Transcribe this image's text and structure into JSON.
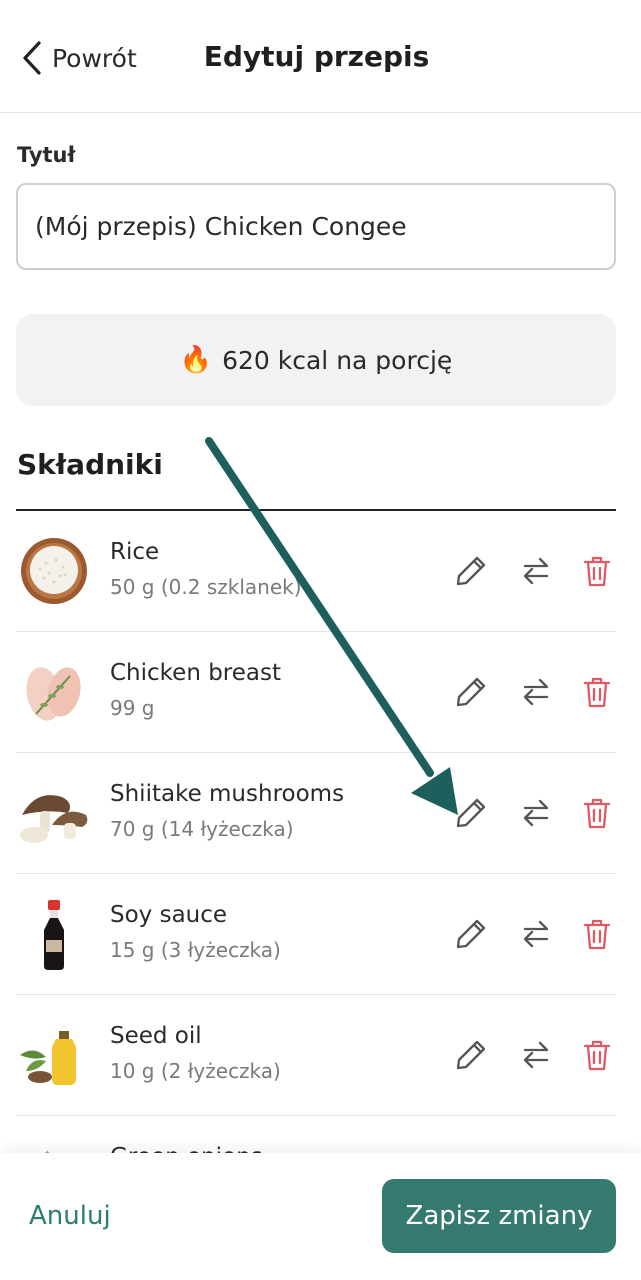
{
  "header": {
    "back_label": "Powrót",
    "title": "Edytuj przepis"
  },
  "form": {
    "title_label": "Tytuł",
    "title_value": "(Mój przepis) Chicken Congee"
  },
  "calories": {
    "icon": "fire-icon",
    "text": "620 kcal na porcję"
  },
  "ingredients": {
    "heading": "Składniki",
    "items": [
      {
        "name": "Rice",
        "amount": "50 g (0.2 szklanek)",
        "icon": "rice-bowl"
      },
      {
        "name": "Chicken breast",
        "amount": "99 g",
        "icon": "chicken-breast"
      },
      {
        "name": "Shiitake mushrooms",
        "amount": "70 g (14 łyżeczka)",
        "icon": "mushrooms"
      },
      {
        "name": "Soy sauce",
        "amount": "15 g (3 łyżeczka)",
        "icon": "soy-sauce-bottle"
      },
      {
        "name": "Seed oil",
        "amount": "10 g (2 łyżeczka)",
        "icon": "oil-bottle"
      },
      {
        "name": "Green onions",
        "amount": "",
        "icon": "green-onions"
      }
    ]
  },
  "footer": {
    "cancel_label": "Anuluj",
    "save_label": "Zapisz zmiany"
  },
  "colors": {
    "accent": "#36796e",
    "delete": "#e05a63",
    "arrow": "#1d5f5b"
  }
}
